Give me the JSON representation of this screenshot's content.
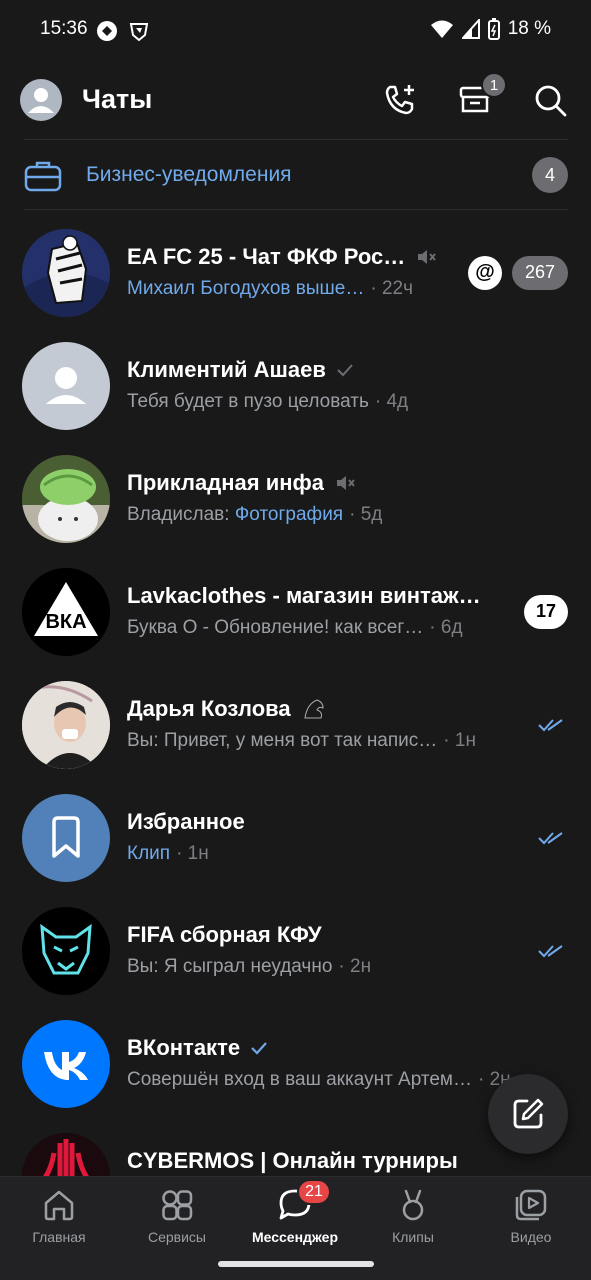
{
  "status_bar": {
    "time": "15:36",
    "battery": "18 %"
  },
  "header": {
    "title": "Чаты",
    "archive_badge": "1"
  },
  "business": {
    "label": "Бизнес-уведомления",
    "count": "4"
  },
  "chats": [
    {
      "name": "EA FC 25 - Чат ФКФ Рос…",
      "sender": "",
      "preview": "Михаил Богодухов выше…",
      "time": "· 22ч",
      "unread": "267",
      "mention": "@",
      "muted": true
    },
    {
      "name": "Климентий Ашаев",
      "sender": "",
      "preview": "Тебя будет в пузо целовать",
      "time": "· 4д"
    },
    {
      "name": "Прикладная инфа",
      "sender": "Владислав: ",
      "preview": "Фотография",
      "time": "· 5д",
      "muted": true
    },
    {
      "name": "Lavkaclothes - магазин винтаж…",
      "sender": "",
      "preview": "Буква О - Обновление!  как всег…",
      "time": "· 6д",
      "unread": "17"
    },
    {
      "name": "Дарья Козлова",
      "sender": "",
      "preview": "Вы: Привет, у меня вот так напис…",
      "time": "· 1н"
    },
    {
      "name": "Избранное",
      "sender": "",
      "preview": "Клип",
      "time": "· 1н"
    },
    {
      "name": "FIFA сборная КФУ",
      "sender": "",
      "preview": "Вы: Я сыграл неудачно",
      "time": "· 2н"
    },
    {
      "name": "ВКонтакте",
      "sender": "",
      "preview": "Совершён вход в ваш аккаунт Артем…",
      "time": "· 2н"
    },
    {
      "name": "CYBERMOS | Онлайн турниры",
      "sender": "",
      "preview": "",
      "time": ""
    }
  ],
  "avatar_text": {
    "lavka": "ВКА"
  },
  "bottom_nav": {
    "items": [
      {
        "label": "Главная"
      },
      {
        "label": "Сервисы"
      },
      {
        "label": "Мессенджер",
        "badge": "21"
      },
      {
        "label": "Клипы"
      },
      {
        "label": "Видео"
      }
    ]
  },
  "colors": {
    "accent": "#71aaeb",
    "background": "#19191a",
    "badge_red": "#e64646"
  }
}
